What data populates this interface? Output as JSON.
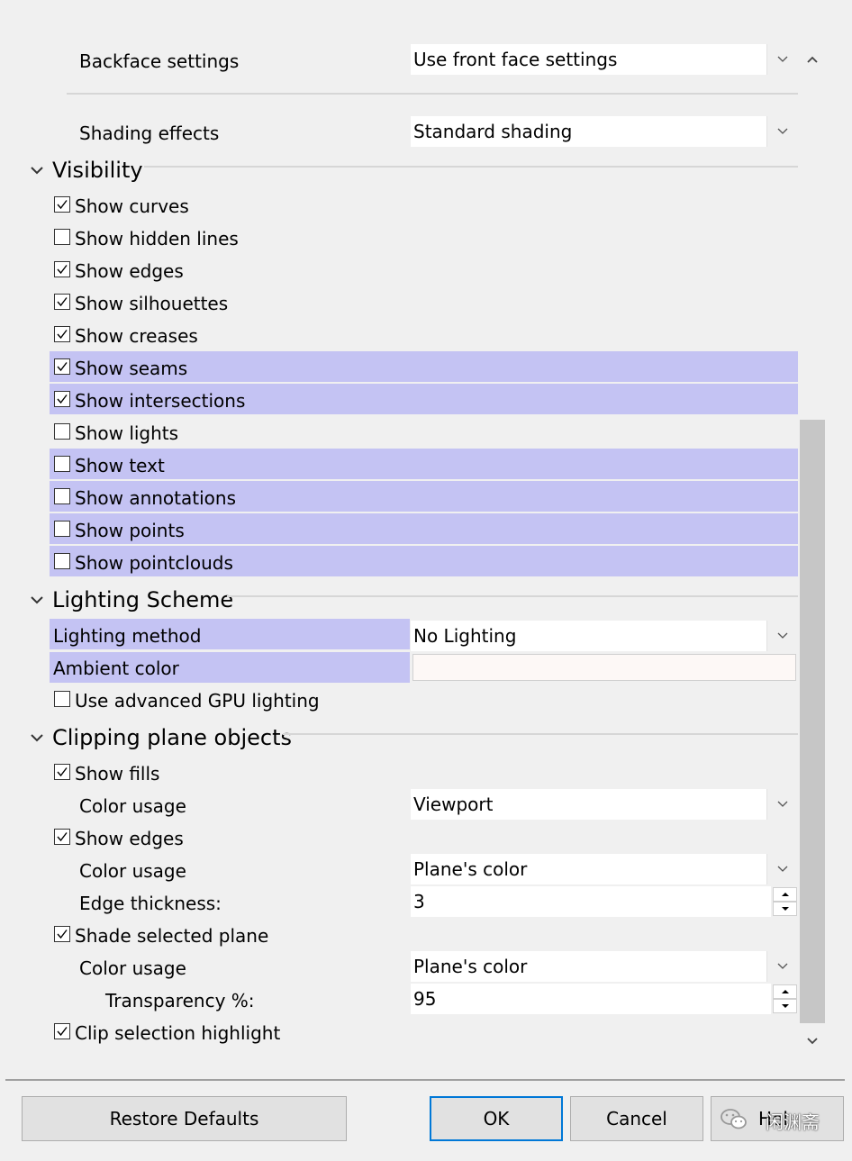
{
  "top": {
    "backface_label": "Backface settings",
    "backface_value": "Use front face settings",
    "shading_label": "Shading effects",
    "shading_value": "Standard shading"
  },
  "visibility": {
    "title": "Visibility",
    "items": [
      {
        "label": "Show curves",
        "checked": true,
        "highlighted": false
      },
      {
        "label": "Show hidden lines",
        "checked": false,
        "highlighted": false
      },
      {
        "label": "Show edges",
        "checked": true,
        "highlighted": false
      },
      {
        "label": "Show silhouettes",
        "checked": true,
        "highlighted": false
      },
      {
        "label": "Show creases",
        "checked": true,
        "highlighted": false
      },
      {
        "label": "Show seams",
        "checked": true,
        "highlighted": true
      },
      {
        "label": "Show intersections",
        "checked": true,
        "highlighted": true
      },
      {
        "label": "Show lights",
        "checked": false,
        "highlighted": false
      },
      {
        "label": "Show text",
        "checked": false,
        "highlighted": true
      },
      {
        "label": "Show annotations",
        "checked": false,
        "highlighted": true
      },
      {
        "label": "Show points",
        "checked": false,
        "highlighted": true
      },
      {
        "label": "Show pointclouds",
        "checked": false,
        "highlighted": true
      }
    ]
  },
  "lighting": {
    "title": "Lighting Scheme",
    "method_label": "Lighting method",
    "method_value": "No Lighting",
    "ambient_label": "Ambient color",
    "gpu_label": "Use advanced GPU lighting",
    "gpu_checked": false
  },
  "clipping": {
    "title": "Clipping plane objects",
    "show_fills_label": "Show fills",
    "show_fills_checked": true,
    "fills_color_label": "Color usage",
    "fills_color_value": "Viewport",
    "show_edges_label": "Show edges",
    "show_edges_checked": true,
    "edges_color_label": "Color usage",
    "edges_color_value": "Plane's color",
    "edge_thickness_label": "Edge thickness:",
    "edge_thickness_value": "3",
    "shade_label": "Shade selected plane",
    "shade_checked": true,
    "shade_color_label": "Color usage",
    "shade_color_value": "Plane's color",
    "transparency_label": "Transparency %:",
    "transparency_value": "95",
    "clip_highlight_label": "Clip selection highlight",
    "clip_highlight_checked": true
  },
  "footer": {
    "restore_label": "Restore Defaults",
    "ok_label": "OK",
    "cancel_label": "Cancel",
    "help_label": "Hel",
    "watermark_text": "闲渊斋"
  },
  "colors": {
    "highlight": "#c4c3f3",
    "accent": "#0078d7"
  }
}
